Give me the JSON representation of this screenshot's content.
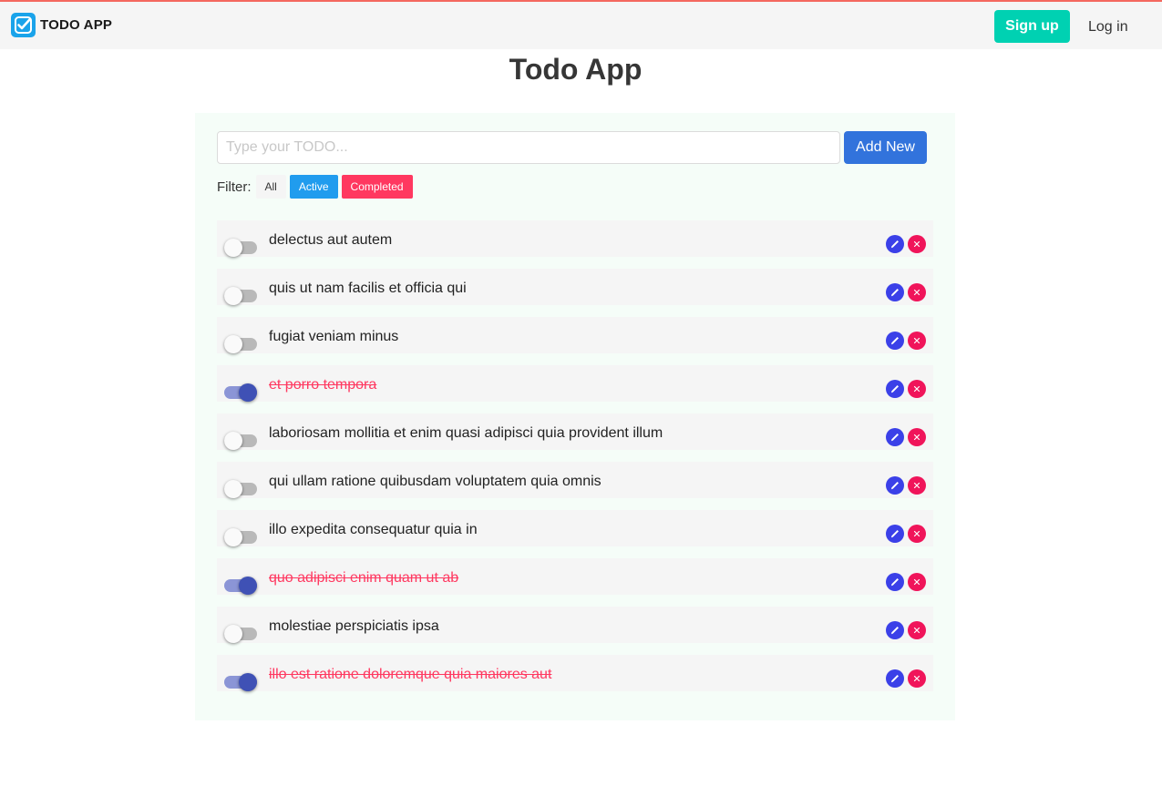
{
  "navbar": {
    "brand_label": "TODO APP",
    "signup_label": "Sign up",
    "login_label": "Log in"
  },
  "page": {
    "title": "Todo App"
  },
  "form": {
    "placeholder": "Type your TODO...",
    "value": "",
    "add_label": "Add New"
  },
  "filter": {
    "label": "Filter:",
    "options": [
      "All",
      "Active",
      "Completed"
    ]
  },
  "todos": [
    {
      "text": "delectus aut autem",
      "completed": false
    },
    {
      "text": "quis ut nam facilis et officia qui",
      "completed": false
    },
    {
      "text": "fugiat veniam minus",
      "completed": false
    },
    {
      "text": "et porro tempora",
      "completed": true
    },
    {
      "text": "laboriosam mollitia et enim quasi adipisci quia provident illum",
      "completed": false
    },
    {
      "text": "qui ullam ratione quibusdam voluptatem quia omnis",
      "completed": false
    },
    {
      "text": "illo expedita consequatur quia in",
      "completed": false
    },
    {
      "text": "quo adipisci enim quam ut ab",
      "completed": true
    },
    {
      "text": "molestiae perspiciatis ipsa",
      "completed": false
    },
    {
      "text": "illo est ratione doloremque quia maiores aut",
      "completed": true
    }
  ],
  "icons": {
    "brand": "checkbox-check-icon",
    "edit": "pencil-icon",
    "delete": "close-icon"
  },
  "colors": {
    "accent_top_border": "#f4685f",
    "signup": "#00d1b2",
    "add_button": "#3273dc",
    "filter_active": "#209cee",
    "filter_completed": "#ff3860",
    "completed_text": "#ff3860",
    "toggle_on": "#3f51b5",
    "edit_button": "#3b40e8",
    "delete_button": "#f0145a"
  }
}
